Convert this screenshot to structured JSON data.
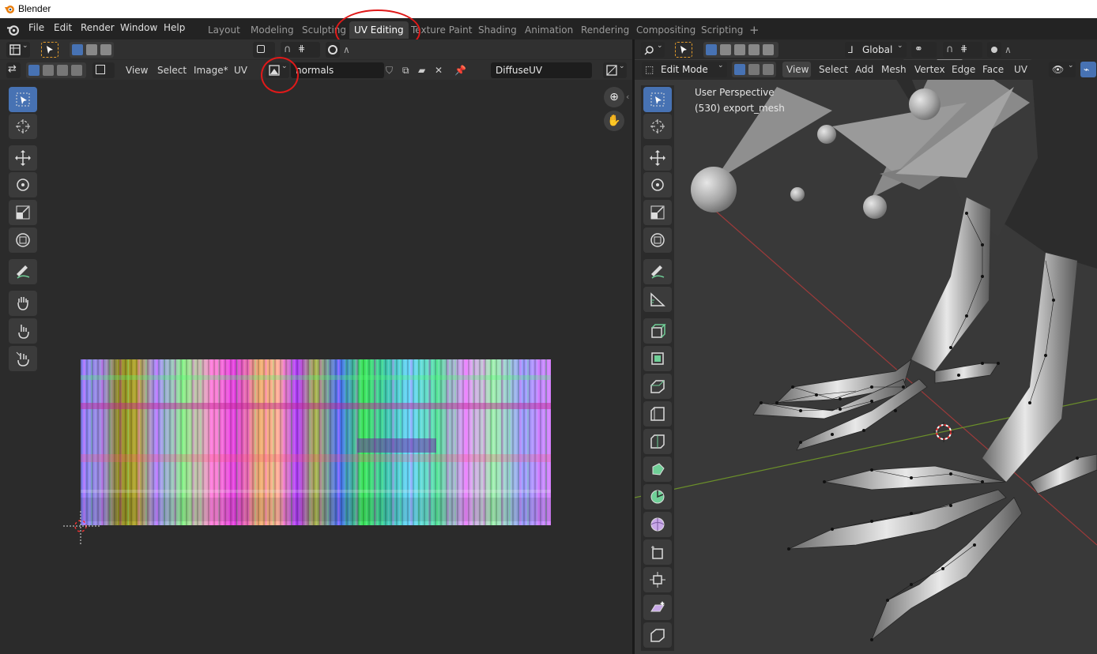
{
  "window": {
    "title": "Blender"
  },
  "menus": [
    "File",
    "Edit",
    "Render",
    "Window",
    "Help"
  ],
  "workspaces": {
    "tabs": [
      "Layout",
      "Modeling",
      "Sculpting",
      "UV Editing",
      "Texture Paint",
      "Shading",
      "Animation",
      "Rendering",
      "Compositing",
      "Scripting"
    ],
    "active": "UV Editing",
    "add": "+"
  },
  "uv_editor": {
    "header_menus": [
      "View",
      "Select",
      "Image*",
      "UV"
    ],
    "image_name": "normals",
    "uv_map": "DiffuseUV"
  },
  "viewport": {
    "mode": "Edit Mode",
    "header_menus": [
      "View",
      "Select",
      "Add",
      "Mesh",
      "Vertex",
      "Edge",
      "Face",
      "UV"
    ],
    "orientation": "Global",
    "overlay_title": "User Perspective",
    "overlay_object": "(530) export_mesh"
  },
  "colors": {
    "accent": "#4772b3",
    "annotation": "#e01919",
    "x_axis": "#9b3a3a",
    "y_axis": "#6b8f2a"
  }
}
